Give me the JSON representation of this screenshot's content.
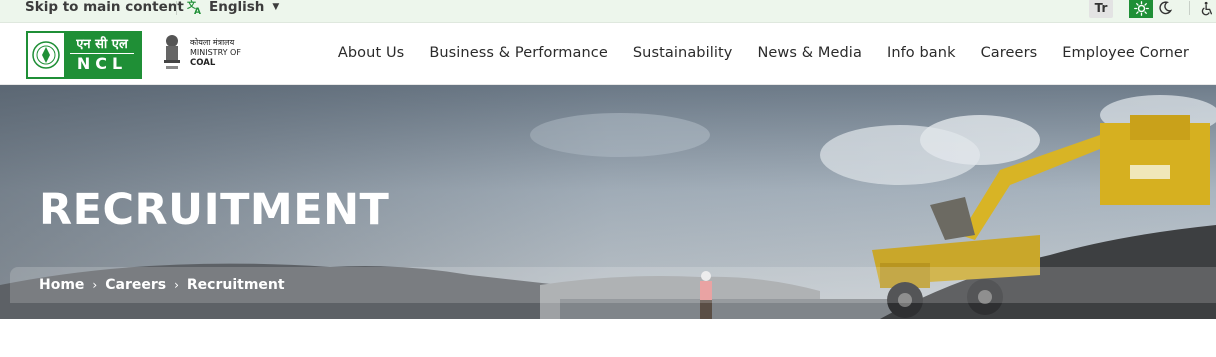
{
  "utility": {
    "skip_link": "Skip to main content",
    "language": "English",
    "text_size_icon": "Tr"
  },
  "logos": {
    "ncl_hindi": "एन सी एल",
    "ncl_english": "NCL",
    "ministry_hindi": "कोयला मंत्रालय",
    "ministry_line1": "MINISTRY OF",
    "ministry_line2": "COAL"
  },
  "nav": {
    "items": [
      "About Us",
      "Business & Performance",
      "Sustainability",
      "News & Media",
      "Info bank",
      "Careers",
      "Employee Corner"
    ]
  },
  "hero": {
    "title": "RECRUITMENT",
    "breadcrumb": [
      "Home",
      "Careers",
      "Recruitment"
    ]
  },
  "colors": {
    "brand_green": "#1f8f36",
    "utility_bg": "#edf6ec"
  }
}
